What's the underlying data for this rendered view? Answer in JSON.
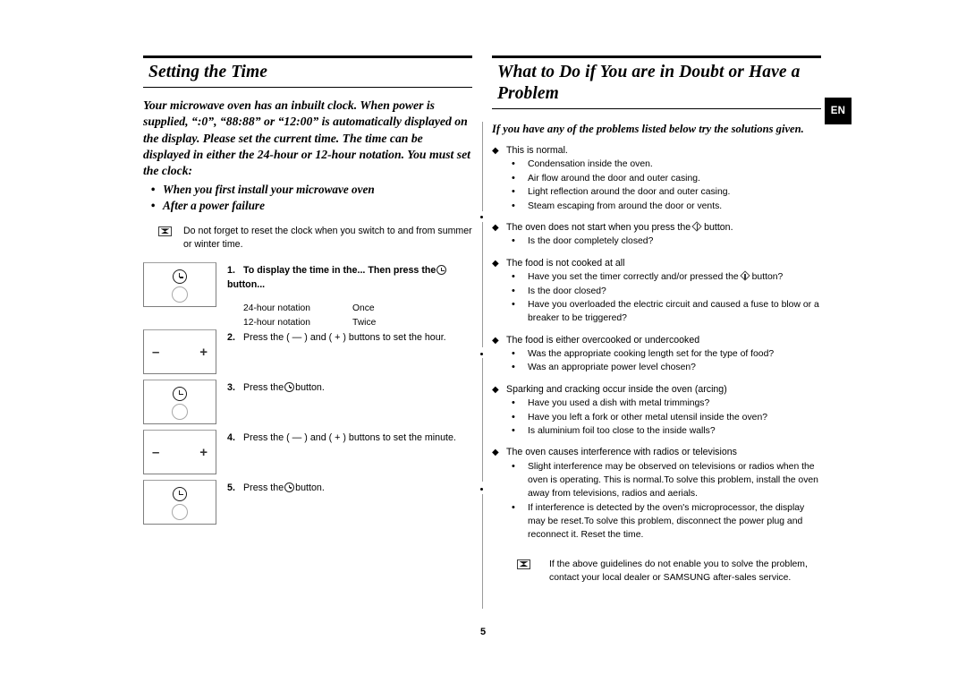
{
  "page": {
    "number": "5",
    "language_badge": "EN"
  },
  "left_column": {
    "title": "Setting the Time",
    "intro": "Your microwave oven has an inbuilt clock. When power is supplied, “:0”, “88:88” or “12:00” is automatically displayed on the display. Please set the current time. The time can be displayed in either the 24-hour or 12-hour notation. You must set the clock:",
    "intro_bullets": [
      "When you first install your microwave oven",
      "After a power failure"
    ],
    "note": {
      "icon": "envelope-icon",
      "text": "Do not forget to reset the clock when you switch to and from summer or winter time."
    },
    "steps": [
      {
        "number": "1.",
        "panel": "clock",
        "text_before": "To display the time in the... Then press the",
        "icon": "clock-icon",
        "text_after": "button...",
        "bold": true,
        "notation_table": {
          "rows": [
            {
              "notation": "24-hour notation",
              "presses": "Once"
            },
            {
              "notation": "12-hour notation",
              "presses": "Twice"
            }
          ]
        }
      },
      {
        "number": "2.",
        "panel": "minus-plus",
        "text_before": "Press the ( — ) and ( + ) buttons to set the hour.",
        "bold": false
      },
      {
        "number": "3.",
        "panel": "clock",
        "text_before": "Press the",
        "icon": "clock-icon",
        "text_after": "button.",
        "bold": false
      },
      {
        "number": "4.",
        "panel": "minus-plus",
        "text_before": "Press the ( — ) and ( + ) buttons to set the minute.",
        "bold": false
      },
      {
        "number": "5.",
        "panel": "clock",
        "text_before": "Press the",
        "icon": "clock-icon",
        "text_after": "button.",
        "bold": false
      }
    ]
  },
  "right_column": {
    "title": "What to Do if You are in Doubt or Have a Problem",
    "intro": "If you have any of the problems listed below try the solutions given.",
    "problems": [
      {
        "heading": "This is normal.",
        "items": [
          "Condensation inside the oven.",
          "Air flow around the door and outer casing.",
          "Light reflection around the door and outer casing.",
          "Steam escaping from around the door or vents."
        ]
      },
      {
        "heading_before": "The oven does not start when you press the",
        "heading_icon": "start-button-icon",
        "heading_after": "button.",
        "items": [
          "Is the door completely closed?"
        ]
      },
      {
        "heading": "The food is not cooked at all",
        "items_rich": [
          {
            "text_before": "Have you set the timer correctly and/or pressed the",
            "icon": "start-button-icon",
            "text_after": "button?"
          }
        ],
        "items": [
          "Is the door closed?",
          "Have you overloaded the electric circuit and caused a fuse to blow or a breaker to be triggered?"
        ]
      },
      {
        "heading": "The food is either overcooked or undercooked",
        "items": [
          "Was the appropriate cooking length set for the type of food?",
          "Was an appropriate power level chosen?"
        ]
      },
      {
        "heading": "Sparking and cracking occur inside the oven (arcing)",
        "items": [
          "Have you used a dish with metal trimmings?",
          "Have you left a fork or other metal utensil inside the oven?",
          "Is aluminium foil too close to the inside walls?"
        ]
      },
      {
        "heading": "The oven causes interference with radios or televisions",
        "items": [
          "Slight interference may be observed on televisions or radios when the oven is operating. This is normal.To solve this problem, install the oven away from televisions, radios and aerials.",
          "If interference is detected by the oven's microprocessor, the display may be reset.To solve this problem, disconnect the power plug and reconnect it. Reset the time."
        ]
      }
    ],
    "note": {
      "icon": "envelope-icon",
      "text": "If the above guidelines do not enable you to solve the problem, contact your local dealer or SAMSUNG after-sales service."
    }
  },
  "symbols": {
    "diamond_bullet": "◆",
    "round_bullet": "•",
    "minus": "–",
    "plus": "+"
  }
}
